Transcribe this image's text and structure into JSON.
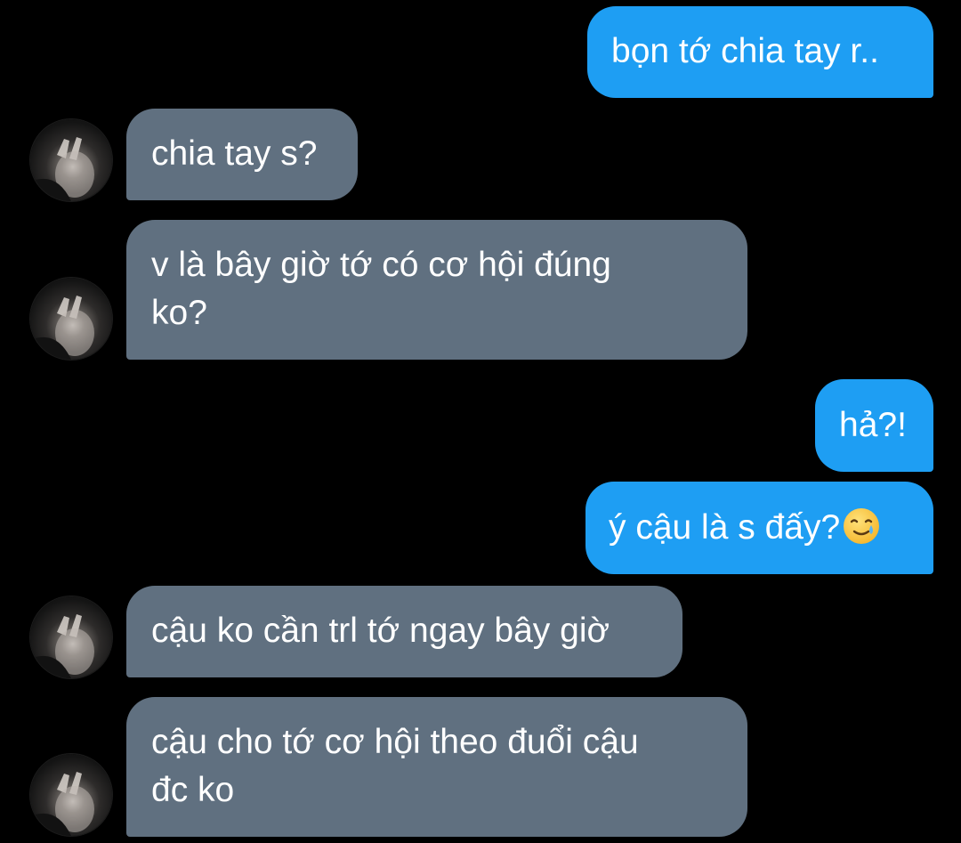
{
  "messages": [
    {
      "id": 1,
      "from": "me",
      "text": "bọn tớ chia tay r.."
    },
    {
      "id": 2,
      "from": "them",
      "text": "chia tay s?"
    },
    {
      "id": 3,
      "from": "them",
      "line1": "v là bây giờ tớ có cơ hội đúng",
      "line2": "ko?"
    },
    {
      "id": 4,
      "from": "me",
      "text": "hả?!"
    },
    {
      "id": 5,
      "from": "me",
      "text": "ý cậu là s đấy?",
      "emoji": "smiling-face-with-tear"
    },
    {
      "id": 6,
      "from": "them",
      "text": "cậu ko cần trl tớ ngay bây giờ"
    },
    {
      "id": 7,
      "from": "them",
      "line1": "cậu cho tớ cơ hội theo đuổi cậu",
      "line2": "đc ko"
    }
  ],
  "colors": {
    "background": "#000000",
    "sent_bubble": "#1e9ef3",
    "received_bubble": "#607080",
    "text": "#ffffff"
  },
  "icons": {
    "avatar": "contact-avatar-photo",
    "emoji": "smiling-face-with-tear-emoji"
  }
}
